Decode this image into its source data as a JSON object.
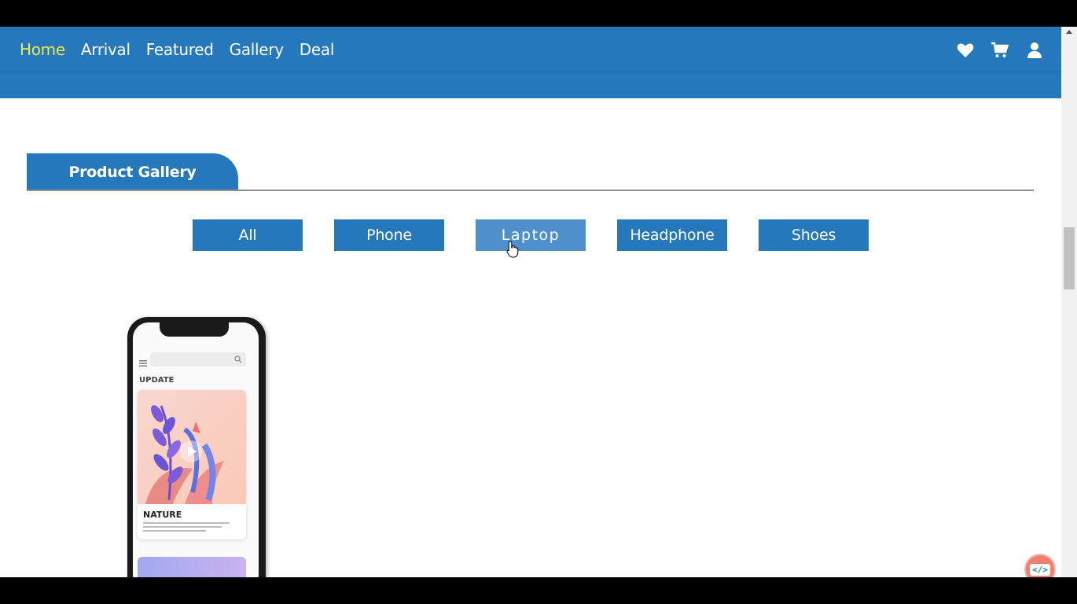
{
  "nav": {
    "items": [
      {
        "label": "Home",
        "active": true
      },
      {
        "label": "Arrival",
        "active": false
      },
      {
        "label": "Featured",
        "active": false
      },
      {
        "label": "Gallery",
        "active": false
      },
      {
        "label": "Deal",
        "active": false
      }
    ],
    "icons": [
      "heart-icon",
      "cart-icon",
      "user-icon"
    ]
  },
  "section": {
    "title": "Product Gallery"
  },
  "filters": [
    {
      "label": "All"
    },
    {
      "label": "Phone"
    },
    {
      "label": "Laptop",
      "hovered": true
    },
    {
      "label": "Headphone"
    },
    {
      "label": "Shoes"
    }
  ],
  "product_preview": {
    "heading": "UPDATE",
    "card_title": "NATURE"
  },
  "badge": {
    "label": "</>"
  },
  "colors": {
    "primary": "#2678bd",
    "active_nav": "#f0e94a",
    "hover_filter": "#4f8fcb"
  }
}
